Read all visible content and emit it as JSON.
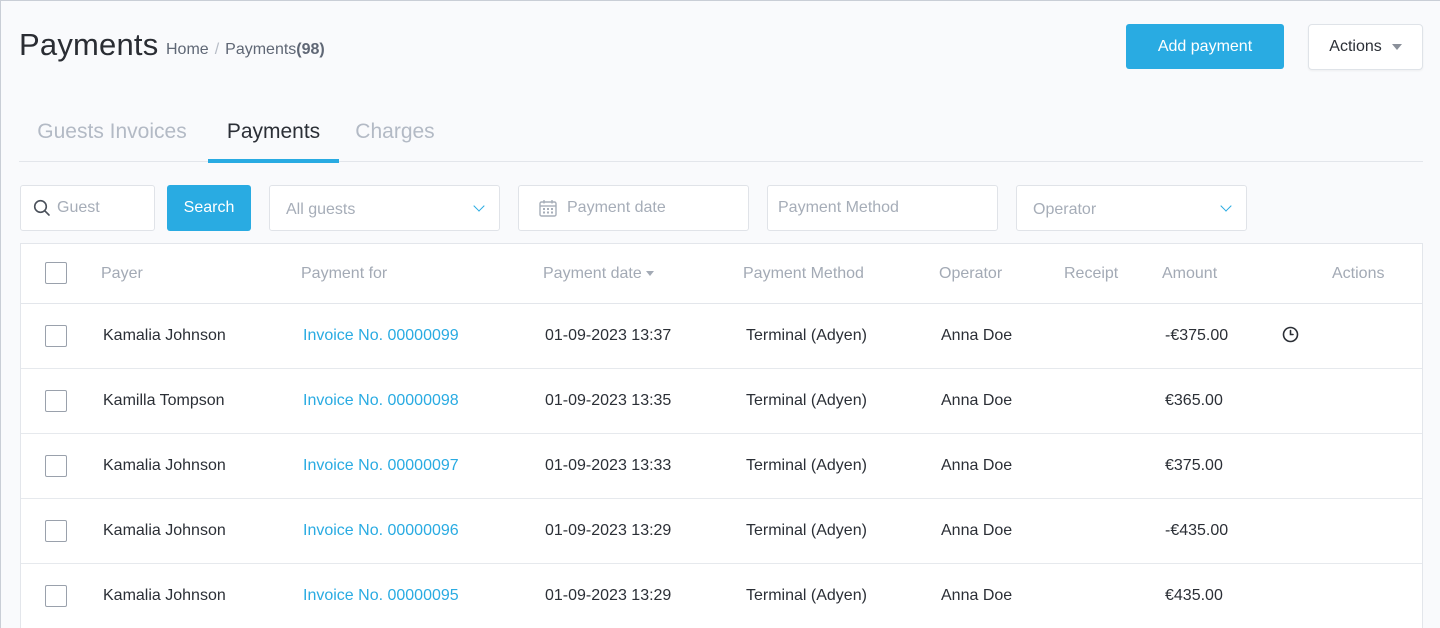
{
  "header": {
    "title": "Payments",
    "breadcrumb": {
      "home": "Home",
      "separator": "/",
      "current": "Payments",
      "count": "(98)"
    },
    "add_payment_label": "Add payment",
    "actions_label": "Actions"
  },
  "tabs": [
    {
      "label": "Guests Invoices",
      "active": false
    },
    {
      "label": "Payments",
      "active": true
    },
    {
      "label": "Charges",
      "active": false
    }
  ],
  "filters": {
    "guest_placeholder": "Guest",
    "search_label": "Search",
    "all_guests": "All guests",
    "payment_date_placeholder": "Payment date",
    "payment_method_placeholder": "Payment Method",
    "operator": "Operator"
  },
  "table": {
    "columns": [
      "Payer",
      "Payment for",
      "Payment date",
      "Payment Method",
      "Operator",
      "Receipt",
      "Amount",
      "Actions"
    ],
    "rows": [
      {
        "payer": "Kamalia Johnson",
        "payment_for": "Invoice No. 00000099",
        "date": "01-09-2023 13:37",
        "method": "Terminal (Adyen)",
        "operator": "Anna Doe",
        "amount": "-€375.00",
        "icon": "clock-icon"
      },
      {
        "payer": "Kamilla Tompson",
        "payment_for": "Invoice No. 00000098",
        "date": "01-09-2023 13:35",
        "method": "Terminal (Adyen)",
        "operator": "Anna Doe",
        "amount": "€365.00"
      },
      {
        "payer": "Kamalia Johnson",
        "payment_for": "Invoice No. 00000097",
        "date": "01-09-2023 13:33",
        "method": "Terminal (Adyen)",
        "operator": "Anna Doe",
        "amount": "€375.00"
      },
      {
        "payer": "Kamalia Johnson",
        "payment_for": "Invoice No. 00000096",
        "date": "01-09-2023 13:29",
        "method": "Terminal (Adyen)",
        "operator": "Anna Doe",
        "amount": "-€435.00"
      },
      {
        "payer": "Kamalia Johnson",
        "payment_for": "Invoice No. 00000095",
        "date": "01-09-2023 13:29",
        "method": "Terminal (Adyen)",
        "operator": "Anna Doe",
        "amount": "€435.00"
      }
    ]
  },
  "colors": {
    "accent": "#29abe2",
    "text": "#2b2f36",
    "muted": "#a3aab5"
  }
}
